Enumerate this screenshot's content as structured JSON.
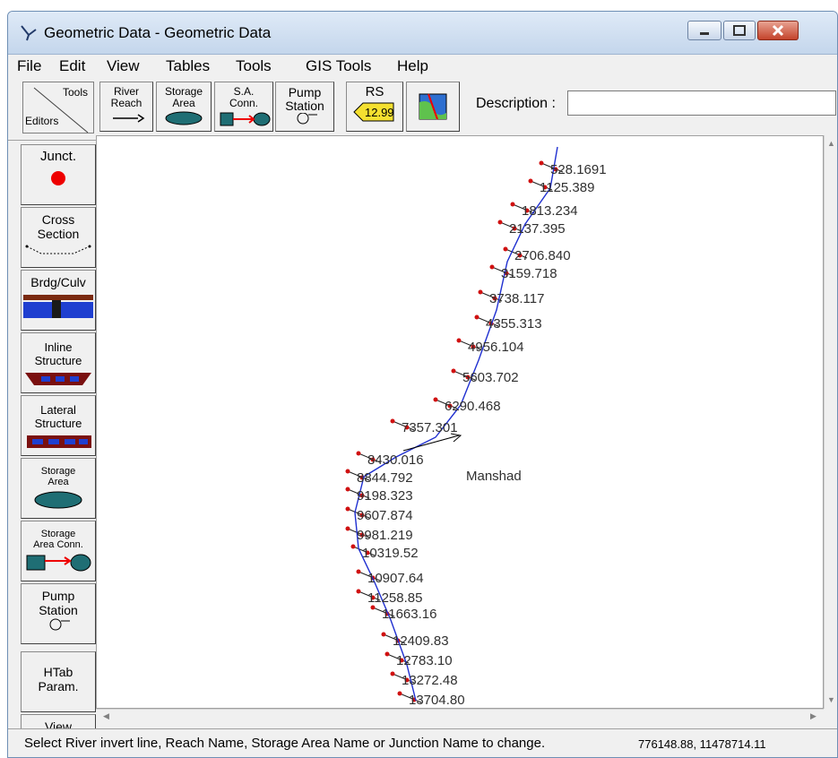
{
  "window": {
    "title": "Geometric Data - Geometric Data"
  },
  "menu": [
    "File",
    "Edit",
    "View",
    "Tables",
    "Tools",
    "GIS Tools",
    "Help"
  ],
  "toolbar": {
    "tools_label": "Tools",
    "editors_label": "Editors",
    "river_reach": "River\nReach",
    "storage_area": "Storage\nArea",
    "sa_conn": "S.A.\nConn.",
    "pump_station": "Pump\nStation",
    "rs_label": "RS",
    "rs_value": "12.99",
    "description_label": "Description :",
    "description_value": ""
  },
  "sidebar": [
    {
      "label": "Junct.",
      "icon": "junction-icon"
    },
    {
      "label": "Cross\nSection",
      "icon": "cross-section-icon"
    },
    {
      "label": "Brdg/Culv",
      "icon": "bridge-icon"
    },
    {
      "label": "Inline\nStructure",
      "icon": "inline-structure-icon"
    },
    {
      "label": "Lateral\nStructure",
      "icon": "lateral-structure-icon"
    },
    {
      "label": "Storage\nArea",
      "icon": "storage-area-icon"
    },
    {
      "label": "Storage\nArea Conn.",
      "icon": "storage-area-conn-icon"
    },
    {
      "label": "Pump\nStation",
      "icon": "pump-icon"
    },
    {
      "label": "HTab\nParam.",
      "icon": ""
    },
    {
      "label": "View",
      "icon": ""
    }
  ],
  "map": {
    "reach_name": "Manshad",
    "cross_sections": [
      "528.1691",
      "1125.389",
      "1813.234",
      "2137.395",
      "2706.840",
      "3159.718",
      "3738.117",
      "4355.313",
      "4956.104",
      "5603.702",
      "6290.468",
      "7357.301",
      "8430.016",
      "8844.792",
      "9198.323",
      "9607.874",
      "9981.219",
      "10319.52",
      "10907.64",
      "11258.85",
      "11663.16",
      "12409.83",
      "12783.10",
      "13272.48",
      "13704.80"
    ]
  },
  "status": {
    "message": "Select River invert line, Reach Name, Storage Area Name or Junction Name to change.",
    "coordinates": "776148.88, 11478714.11"
  },
  "colors": {
    "river_line": "#1f2fd0",
    "bank_point": "#d01010",
    "cross_section": "#202020"
  }
}
